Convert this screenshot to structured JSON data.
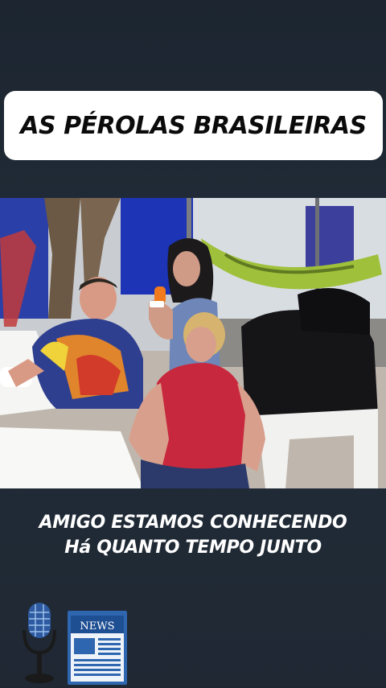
{
  "header": {
    "title": "AS PÉROLAS BRASILEIRAS"
  },
  "caption": {
    "line1": "AMIGO ESTAMOS CONHECENDO",
    "line2": "Há QUANTO TEMPO JUNTO"
  },
  "icons": {
    "microphone": "microphone-icon",
    "newspaper": "newspaper-icon",
    "news_label": "NEWS"
  },
  "colors": {
    "background": "#1f2833",
    "title_box": "#ffffff",
    "title_text": "#0b0b0b",
    "caption_text": "#ffffff"
  }
}
